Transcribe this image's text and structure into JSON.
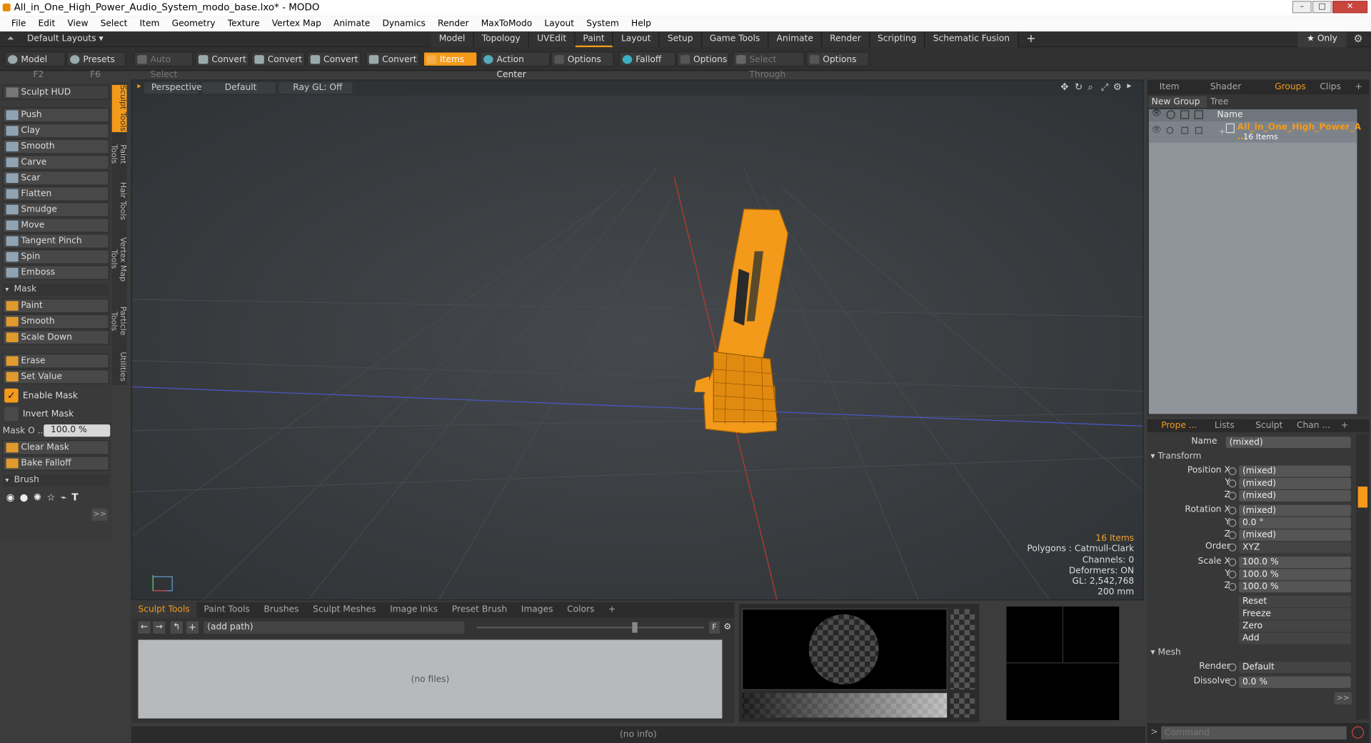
{
  "window": {
    "title": "All_in_One_High_Power_Audio_System_modo_base.lxo* - MODO",
    "min": "–",
    "max": "□",
    "close": "✕"
  },
  "menu": [
    "File",
    "Edit",
    "View",
    "Select",
    "Item",
    "Geometry",
    "Texture",
    "Vertex Map",
    "Animate",
    "Dynamics",
    "Render",
    "MaxToModo",
    "Layout",
    "System",
    "Help"
  ],
  "layoutbar": {
    "layouts": "Default Layouts ▾",
    "tabs": [
      "Model",
      "Topology",
      "UVEdit",
      "Paint",
      "Layout",
      "Setup",
      "Game Tools",
      "Animate",
      "Render",
      "Scripting",
      "Schematic Fusion"
    ],
    "active_tab": "Paint",
    "add": "+",
    "only": "★ Only"
  },
  "toolbar": {
    "model": "Model",
    "model_key": "F2",
    "presets": "Presets",
    "presets_key": "F6",
    "auto_select": "Auto Select",
    "convert1": "Convert",
    "convert2": "Convert",
    "convert3": "Convert",
    "convert4": "Convert",
    "items": "Items",
    "action_center": "Action Center",
    "options1": "Options",
    "falloff": "Falloff",
    "options2": "Options",
    "select_through": "Select Through",
    "options3": "Options"
  },
  "sculpt": {
    "hud": "Sculpt HUD",
    "tools": [
      "Push",
      "Clay",
      "Smooth",
      "Carve",
      "Scar",
      "Flatten",
      "Smudge",
      "Move",
      "Tangent Pinch",
      "Spin",
      "Emboss"
    ],
    "mask_header": "Mask",
    "mask_tools": [
      "Paint",
      "Smooth",
      "Scale Down"
    ],
    "erase": "Erase",
    "set_value": "Set Value",
    "enable_mask": "Enable Mask",
    "invert_mask": "Invert Mask",
    "mask_opacity_label": "Mask O ...",
    "mask_opacity": "100.0 %",
    "clear_mask": "Clear Mask",
    "bake_falloff": "Bake Falloff",
    "brush_header": "Brush",
    "more": ">>"
  },
  "side_tabs": [
    "Sculpt Tools",
    "Paint Tools",
    "Hair Tools",
    "Vertex Map Tools",
    "Particle Tools",
    "Utilities"
  ],
  "viewport": {
    "view": "Perspective",
    "shading": "Default",
    "raygl": "Ray GL: Off",
    "stats": {
      "items": "16 Items",
      "polygons": "Polygons : Catmull-Clark",
      "channels": "Channels: 0",
      "deformers": "Deformers: ON",
      "gl": "GL: 2,542,768",
      "scale": "200 mm"
    },
    "accent": "#f39a1b"
  },
  "bottom": {
    "tabs": [
      "Sculpt Tools",
      "Paint Tools",
      "Brushes",
      "Sculpt Meshes",
      "Image Inks",
      "Preset Brush",
      "Images",
      "Colors",
      "+"
    ],
    "path": "(add path)",
    "no_files": "(no files)",
    "status": "(no info)"
  },
  "right_top": {
    "tabs": [
      "Item List",
      "Shader Tree",
      "Groups",
      "Clips",
      "+"
    ],
    "active": "Groups",
    "new_group": "New Group",
    "name_col": "Name",
    "group_name": "All_in_One_High_Power_A ...",
    "group_count": "16 Items"
  },
  "properties": {
    "tabs": [
      "Prope ...",
      "Lists",
      "Sculpt",
      "Chan ...",
      "+"
    ],
    "name_label": "Name",
    "name_value": "(mixed)",
    "transform": "Transform",
    "rows": [
      {
        "label": "Position X",
        "value": "(mixed)"
      },
      {
        "label": "Y",
        "value": "(mixed)"
      },
      {
        "label": "Z",
        "value": "(mixed)"
      },
      {
        "label": "Rotation X",
        "value": "(mixed)"
      },
      {
        "label": "Y",
        "value": "0.0 °"
      },
      {
        "label": "Z",
        "value": "(mixed)"
      },
      {
        "label": "Order",
        "value": "XYZ"
      },
      {
        "label": "Scale X",
        "value": "100.0 %"
      },
      {
        "label": "Y",
        "value": "100.0 %"
      },
      {
        "label": "Z",
        "value": "100.0 %"
      }
    ],
    "actions": [
      "Reset",
      "Freeze",
      "Zero",
      "Add"
    ],
    "mesh": "Mesh",
    "render_label": "Render",
    "render_value": "Default",
    "dissolve_label": "Dissolve",
    "dissolve_value": "0.0 %",
    "more": ">>",
    "command_placeholder": "Command"
  }
}
